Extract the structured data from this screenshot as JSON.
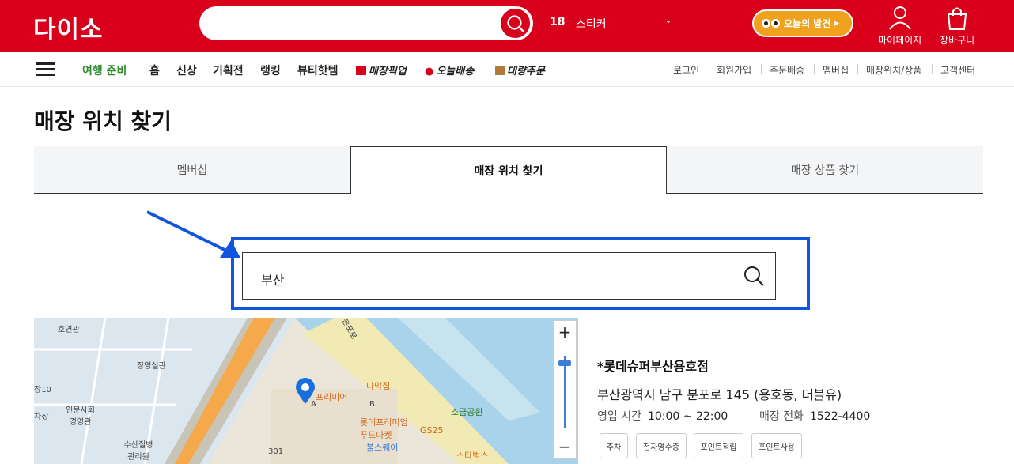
{
  "header": {
    "logo": "다이소",
    "search_placeholder": "",
    "trending_rank": "18",
    "trending_word": "스티커",
    "discover_label": "오늘의 발견",
    "mypage_label": "마이페이지",
    "cart_label": "장바구니"
  },
  "nav": {
    "items": [
      "여행 준비",
      "홈",
      "신상",
      "기획전",
      "랭킹",
      "뷰티핫템",
      "매장픽업",
      "오늘배송",
      "대량주문"
    ],
    "utility": [
      "로그인",
      "회원가입",
      "주문배송",
      "멤버십",
      "매장위치/상품",
      "고객센터"
    ]
  },
  "page": {
    "title": "매장 위치 찾기",
    "tabs": [
      "멤버십",
      "매장 위치 찾기",
      "매장 상품 찾기"
    ],
    "store_search_value": "부산"
  },
  "map": {
    "labels": [
      "호연관",
      "장영실관",
      "장10",
      "차장",
      "인문사회 경영관",
      "수산질병 관리원",
      "301",
      "프리미어",
      "나막집",
      "B",
      "A",
      "롯데프리미엄 푸드마켓",
      "GS25",
      "소금공원",
      "불스퀘어",
      "스타벅스",
      "분포로"
    ],
    "zoom_in": "+",
    "zoom_out": "−"
  },
  "store": {
    "name": "*롯데슈퍼부산용호점",
    "address": "부산광역시 남구 분포로 145 (용호동, 더블유)",
    "hours_label": "영업 시간",
    "hours": "10:00 ~ 22:00",
    "phone_label": "매장 전화",
    "phone": "1522-4400",
    "amenities": [
      "주차",
      "전자영수증",
      "포인트적립",
      "포인트사용"
    ]
  },
  "colors": {
    "brand_red": "#d9001b",
    "highlight_blue": "#1155dd",
    "nav_green": "#2e8b2e"
  }
}
